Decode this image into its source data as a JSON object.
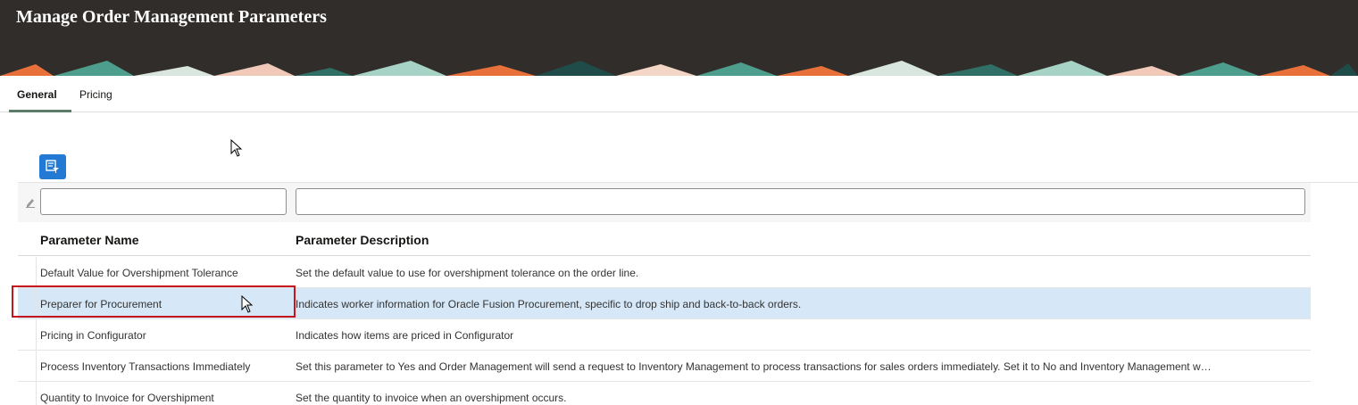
{
  "page": {
    "title": "Manage Order Management Parameters"
  },
  "tabs": [
    {
      "label": "General",
      "active": true
    },
    {
      "label": "Pricing",
      "active": false
    }
  ],
  "toolbar": {
    "filter_icon": "query-by-example-icon"
  },
  "table": {
    "filters": {
      "name_value": "",
      "description_value": ""
    },
    "columns": [
      "Parameter Name",
      "Parameter Description"
    ],
    "rows": [
      {
        "name": "Default Value for Overshipment Tolerance",
        "description": "Set the default value to use for overshipment tolerance on the order line.",
        "selected": false
      },
      {
        "name": "Preparer for Procurement",
        "description": "Indicates worker information for Oracle Fusion Procurement, specific to drop ship and back-to-back orders.",
        "selected": true
      },
      {
        "name": "Pricing in Configurator",
        "description": "Indicates how items are priced in Configurator",
        "selected": false
      },
      {
        "name": "Process Inventory Transactions Immediately",
        "description": "Set this parameter to Yes and Order Management will send a request to Inventory Management to process transactions for sales orders immediately. Set it to No and Inventory Management w…",
        "selected": false
      },
      {
        "name": "Quantity to Invoice for Overshipment",
        "description": "Set the quantity to invoice when an overshipment occurs.",
        "selected": false
      }
    ]
  },
  "colors": {
    "header_bg": "#312d2a",
    "accent_blue": "#227ad5",
    "selected_row": "#d6e8f7",
    "highlight_red": "#c4161c",
    "tab_underline": "#5c7d6a"
  }
}
